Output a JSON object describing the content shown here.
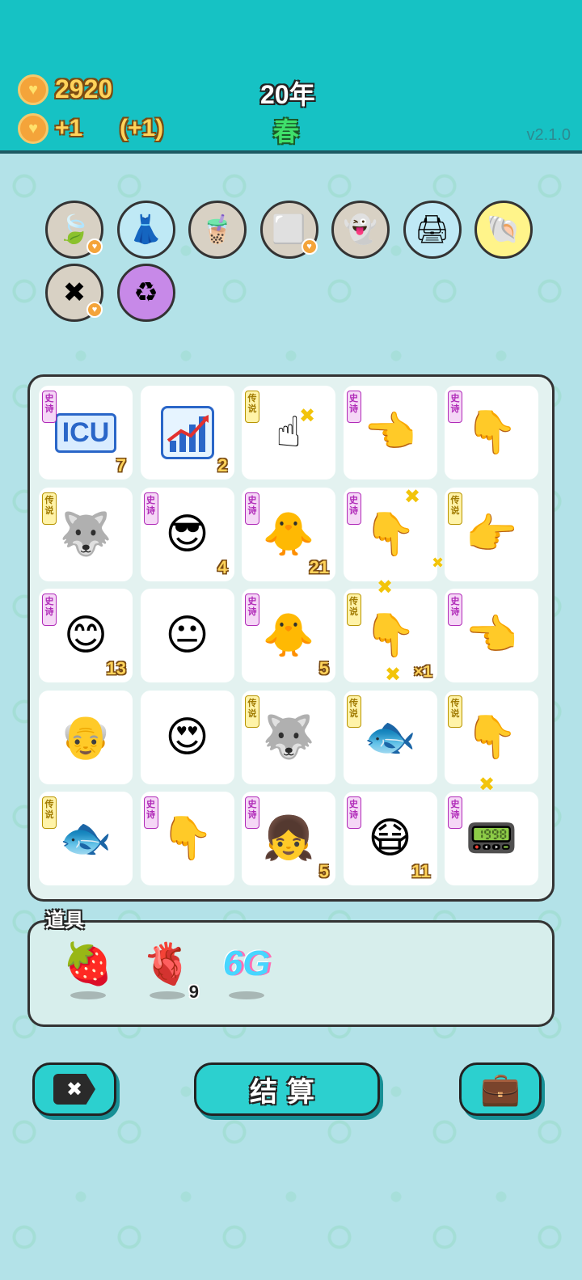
{
  "header": {
    "coins": "2920",
    "income": "+1",
    "income_bonus": "(+1)",
    "year": "20年",
    "season": "春",
    "version": "v2.1.0"
  },
  "top_icons": [
    {
      "name": "leaf-icon",
      "glyph": "🍃",
      "bg": "#d8d1c4",
      "badge": true
    },
    {
      "name": "skirt-icon",
      "glyph": "👗",
      "bg": "#bfe9f5",
      "badge": false
    },
    {
      "name": "bubble-tea-icon",
      "glyph": "🧋",
      "bg": "#d8d1c4",
      "badge": false
    },
    {
      "name": "sugar-cubes-icon",
      "glyph": "⬜",
      "bg": "#d8d1c4",
      "badge": true
    },
    {
      "name": "ghost-icon",
      "glyph": "👻",
      "bg": "#d8d1c4",
      "badge": false
    },
    {
      "name": "printer-icon",
      "glyph": "🖨",
      "bg": "#bfe9f5",
      "badge": false
    },
    {
      "name": "shell-icon",
      "glyph": "🐚",
      "bg": "#fff48a",
      "badge": false
    },
    {
      "name": "delete-tag-icon",
      "glyph": "✖",
      "bg": "#d8d1c4",
      "badge": true
    },
    {
      "name": "recycle-icon",
      "glyph": "♻",
      "bg": "#c789e8",
      "badge": false
    }
  ],
  "tags": {
    "epic": "史诗",
    "legend": "传说"
  },
  "board": [
    {
      "name": "icu-sign",
      "tag": "epic",
      "glyph": "ICU",
      "count": "7"
    },
    {
      "name": "stock-chart",
      "tag": "",
      "glyph": "chart",
      "count": "2"
    },
    {
      "name": "golden-hand-up",
      "tag": "legend",
      "glyph": "☝",
      "count": ""
    },
    {
      "name": "hand-pointing-left",
      "tag": "epic",
      "glyph": "👈",
      "count": ""
    },
    {
      "name": "hand-pointing-down-left",
      "tag": "epic",
      "glyph": "👇",
      "count": ""
    },
    {
      "name": "husky-king",
      "tag": "legend",
      "glyph": "🐺",
      "count": ""
    },
    {
      "name": "man-sunglasses-green-hair",
      "tag": "epic",
      "glyph": "😎",
      "count": "4"
    },
    {
      "name": "yellow-chick",
      "tag": "epic",
      "glyph": "🐥",
      "count": "21"
    },
    {
      "name": "hand-pointing-down",
      "tag": "epic",
      "glyph": "👇",
      "count": ""
    },
    {
      "name": "golden-hand-pointing-right",
      "tag": "legend",
      "glyph": "👉",
      "count": ""
    },
    {
      "name": "pink-face",
      "tag": "epic",
      "glyph": "😊",
      "count": "13"
    },
    {
      "name": "bald-man",
      "tag": "",
      "glyph": "😐",
      "count": ""
    },
    {
      "name": "yellow-chick-2",
      "tag": "epic",
      "glyph": "🐥",
      "count": "5"
    },
    {
      "name": "golden-hand-down",
      "tag": "legend",
      "glyph": "👇",
      "count": ""
    },
    {
      "name": "hand-pointing-left-down",
      "tag": "epic",
      "glyph": "👈",
      "count": ""
    },
    {
      "name": "old-man-glasses",
      "tag": "",
      "glyph": "👴",
      "count": ""
    },
    {
      "name": "old-man-love",
      "tag": "",
      "glyph": "😍",
      "count": ""
    },
    {
      "name": "husky-king-2",
      "tag": "legend",
      "glyph": "🐺",
      "count": ""
    },
    {
      "name": "koi-fish",
      "tag": "legend",
      "glyph": "🐟",
      "count": ""
    },
    {
      "name": "golden-hand-point-down",
      "tag": "legend",
      "glyph": "👇",
      "count": ""
    },
    {
      "name": "koi-fish-2",
      "tag": "legend",
      "glyph": "🐟",
      "count": ""
    },
    {
      "name": "hand-pointing-down-2",
      "tag": "epic",
      "glyph": "👇",
      "count": ""
    },
    {
      "name": "girl-braids",
      "tag": "epic",
      "glyph": "👧",
      "count": "5"
    },
    {
      "name": "man-love-green-hair",
      "tag": "epic",
      "glyph": "😷",
      "count": "11"
    },
    {
      "name": "graphics-card",
      "tag": "epic",
      "glyph": "📟",
      "count": ""
    }
  ],
  "multiplier": "×1",
  "props": {
    "label": "道具",
    "items": [
      {
        "name": "bayberry-icon",
        "glyph": "🍓",
        "qty": ""
      },
      {
        "name": "liver-icon",
        "glyph": "🫀",
        "qty": "9"
      },
      {
        "name": "6g-icon",
        "glyph": "6G",
        "qty": ""
      }
    ]
  },
  "buttons": {
    "delete_glyph": "✖",
    "settle_label": "结算",
    "bag_glyph": "💼"
  }
}
